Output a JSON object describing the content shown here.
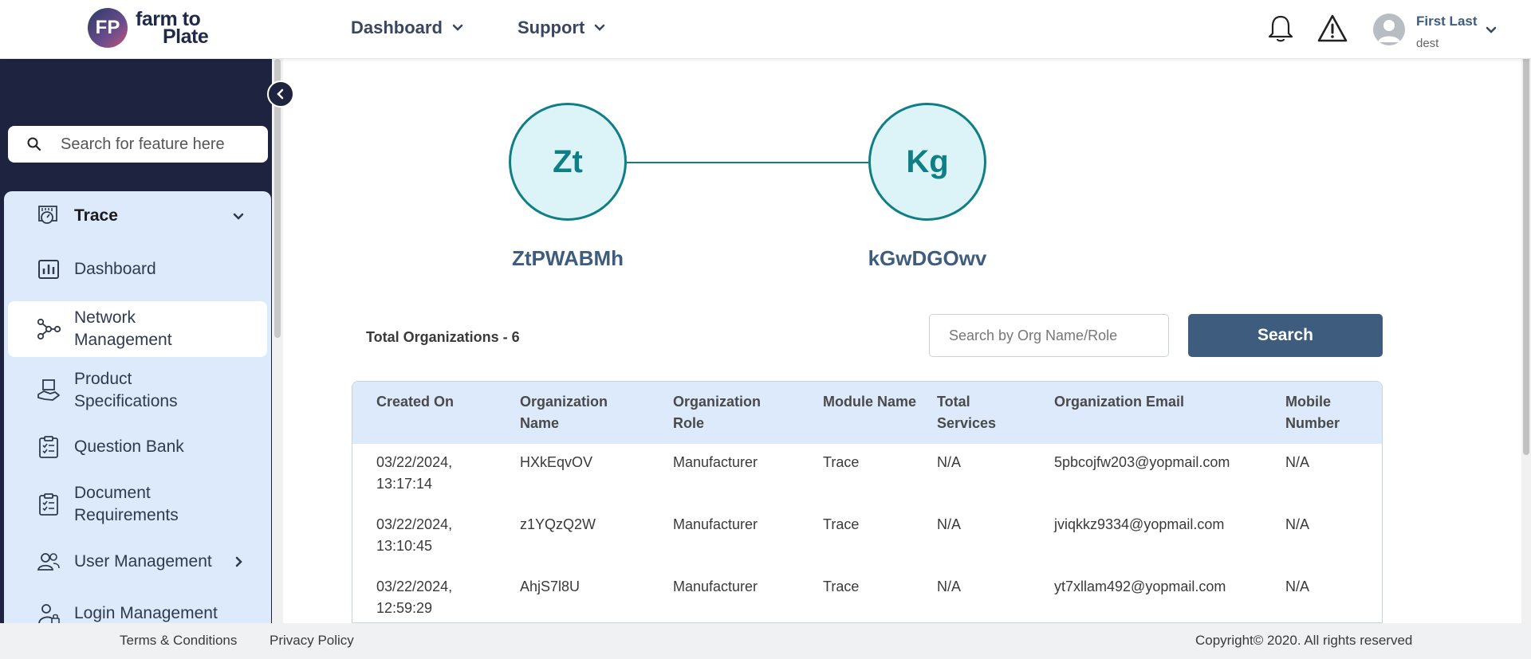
{
  "header": {
    "logo_mark": "FP",
    "logo_line1": "farm to",
    "logo_line2": "Plate",
    "nav": [
      {
        "label": "Dashboard"
      },
      {
        "label": "Support"
      }
    ],
    "user": {
      "name": "First Last",
      "role": "dest"
    }
  },
  "sidebar": {
    "search_placeholder": "Search for feature here",
    "section": {
      "label": "Trace",
      "icon": "trace-icon"
    },
    "items": [
      {
        "label": "Dashboard",
        "icon": "bar-chart-icon"
      },
      {
        "label": "Network Management",
        "icon": "network-icon",
        "active": true
      },
      {
        "label": "Product Specifications",
        "icon": "product-specs-icon"
      },
      {
        "label": "Question Bank",
        "icon": "clipboard-list-icon"
      },
      {
        "label": "Document Requirements",
        "icon": "clipboard-list-icon"
      },
      {
        "label": "User Management",
        "icon": "users-icon"
      },
      {
        "label": "Login Management",
        "icon": "user-lock-icon"
      }
    ]
  },
  "network": {
    "nodes": [
      {
        "initials": "Zt",
        "label": "ZtPWABMh"
      },
      {
        "initials": "Kg",
        "label": "kGwDGOwv"
      }
    ]
  },
  "orgs": {
    "total_label": "Total Organizations - 6",
    "search_placeholder": "Search by Org Name/Role",
    "search_button": "Search",
    "columns": [
      "Created On",
      "Organization Name",
      "Organization Role",
      "Module Name",
      "Total Services",
      "Organization Email",
      "Mobile Number"
    ],
    "rows": [
      {
        "created": "03/22/2024, 13:17:14",
        "name": "HXkEqvOV",
        "role": "Manufacturer",
        "module": "Trace",
        "services": "N/A",
        "email": "5pbcojfw203@yopmail.com",
        "mobile": "N/A"
      },
      {
        "created": "03/22/2024, 13:10:45",
        "name": "z1YQzQ2W",
        "role": "Manufacturer",
        "module": "Trace",
        "services": "N/A",
        "email": "jviqkkz9334@yopmail.com",
        "mobile": "N/A"
      },
      {
        "created": "03/22/2024, 12:59:29",
        "name": "AhjS7l8U",
        "role": "Manufacturer",
        "module": "Trace",
        "services": "N/A",
        "email": "yt7xllam492@yopmail.com",
        "mobile": "N/A"
      }
    ]
  },
  "footer": {
    "terms": "Terms & Conditions",
    "privacy": "Privacy Policy",
    "copyright": "Copyright© 2020. All rights reserved"
  }
}
